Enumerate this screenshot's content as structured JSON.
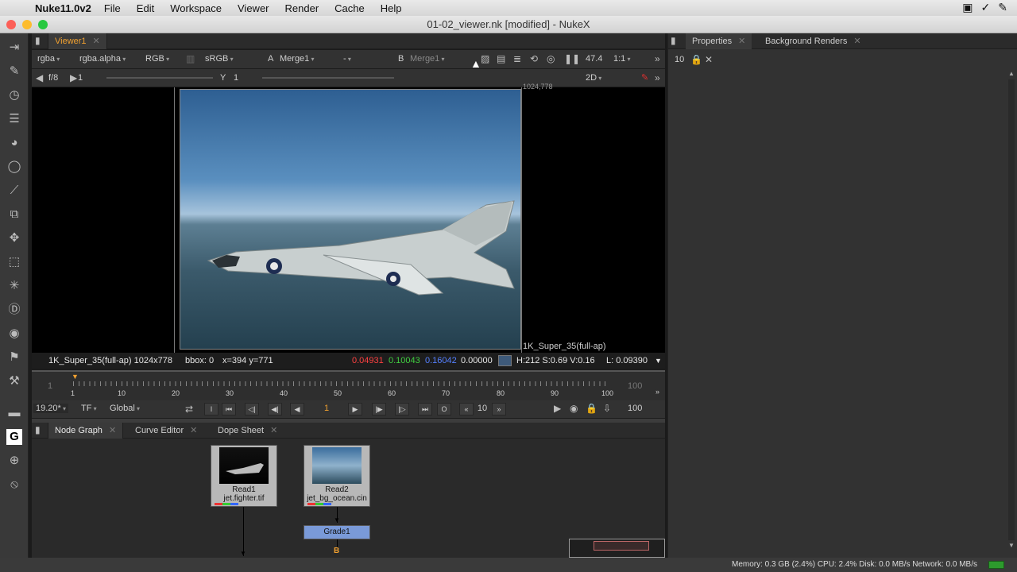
{
  "menubar": {
    "app_name": "Nuke11.0v2",
    "items": [
      "File",
      "Edit",
      "Workspace",
      "Viewer",
      "Render",
      "Cache",
      "Help"
    ]
  },
  "window": {
    "title": "01-02_viewer.nk [modified] - NukeX"
  },
  "viewer": {
    "tab_label": "Viewer1",
    "channels": "rgba",
    "alpha_channel": "rgba.alpha",
    "display": "RGB",
    "lut": "sRGB",
    "input_a_label": "A",
    "input_a": "Merge1",
    "operation": "-",
    "input_b_label": "B",
    "input_b": "Merge1",
    "zoom_percent": "47.4",
    "zoom_ratio": "1:1",
    "fstop": "f/8",
    "gain_value": "1",
    "gamma_label": "Y",
    "gamma_value": "1",
    "view_mode": "2D",
    "format_label": "1K_Super_35(full-ap)",
    "corner_label": "1024,778"
  },
  "infobar": {
    "format": "1K_Super_35(full-ap) 1024x778",
    "bbox": "bbox: 0",
    "coords": "x=394 y=771",
    "r": "0.04931",
    "g": "0.10043",
    "b": "0.16042",
    "a": "0.00000",
    "hsv": "H:212 S:0.69 V:0.16",
    "luma": "L: 0.09390"
  },
  "timeline": {
    "in_frame": "1",
    "out_frame": "100",
    "current_marker": "1",
    "ticks": [
      "1",
      "10",
      "20",
      "30",
      "40",
      "50",
      "60",
      "70",
      "80",
      "90",
      "100"
    ]
  },
  "playback": {
    "fps": "19.20*",
    "timecode_mode": "TF",
    "range_mode": "Global",
    "current_frame": "1",
    "increment": "10",
    "end_frame": "100"
  },
  "nodegraph": {
    "tabs": [
      "Node Graph",
      "Curve Editor",
      "Dope Sheet"
    ],
    "nodes": [
      {
        "name": "Read1",
        "file": "jet.fighter.tif"
      },
      {
        "name": "Read2",
        "file": "jet_bg_ocean.cin"
      },
      {
        "name": "Grade1"
      }
    ],
    "input_b_label": "B"
  },
  "properties": {
    "tabs": [
      "Properties",
      "Background Renders"
    ],
    "max_panels": "10"
  },
  "status": {
    "text": "Memory: 0.3 GB (2.4%) CPU: 2.4% Disk: 0.0 MB/s Network: 0.0 MB/s"
  },
  "colors": {
    "accent": "#f0a030",
    "red": "#ff3b3b",
    "green": "#3bd23b",
    "blue": "#4a7bff"
  }
}
